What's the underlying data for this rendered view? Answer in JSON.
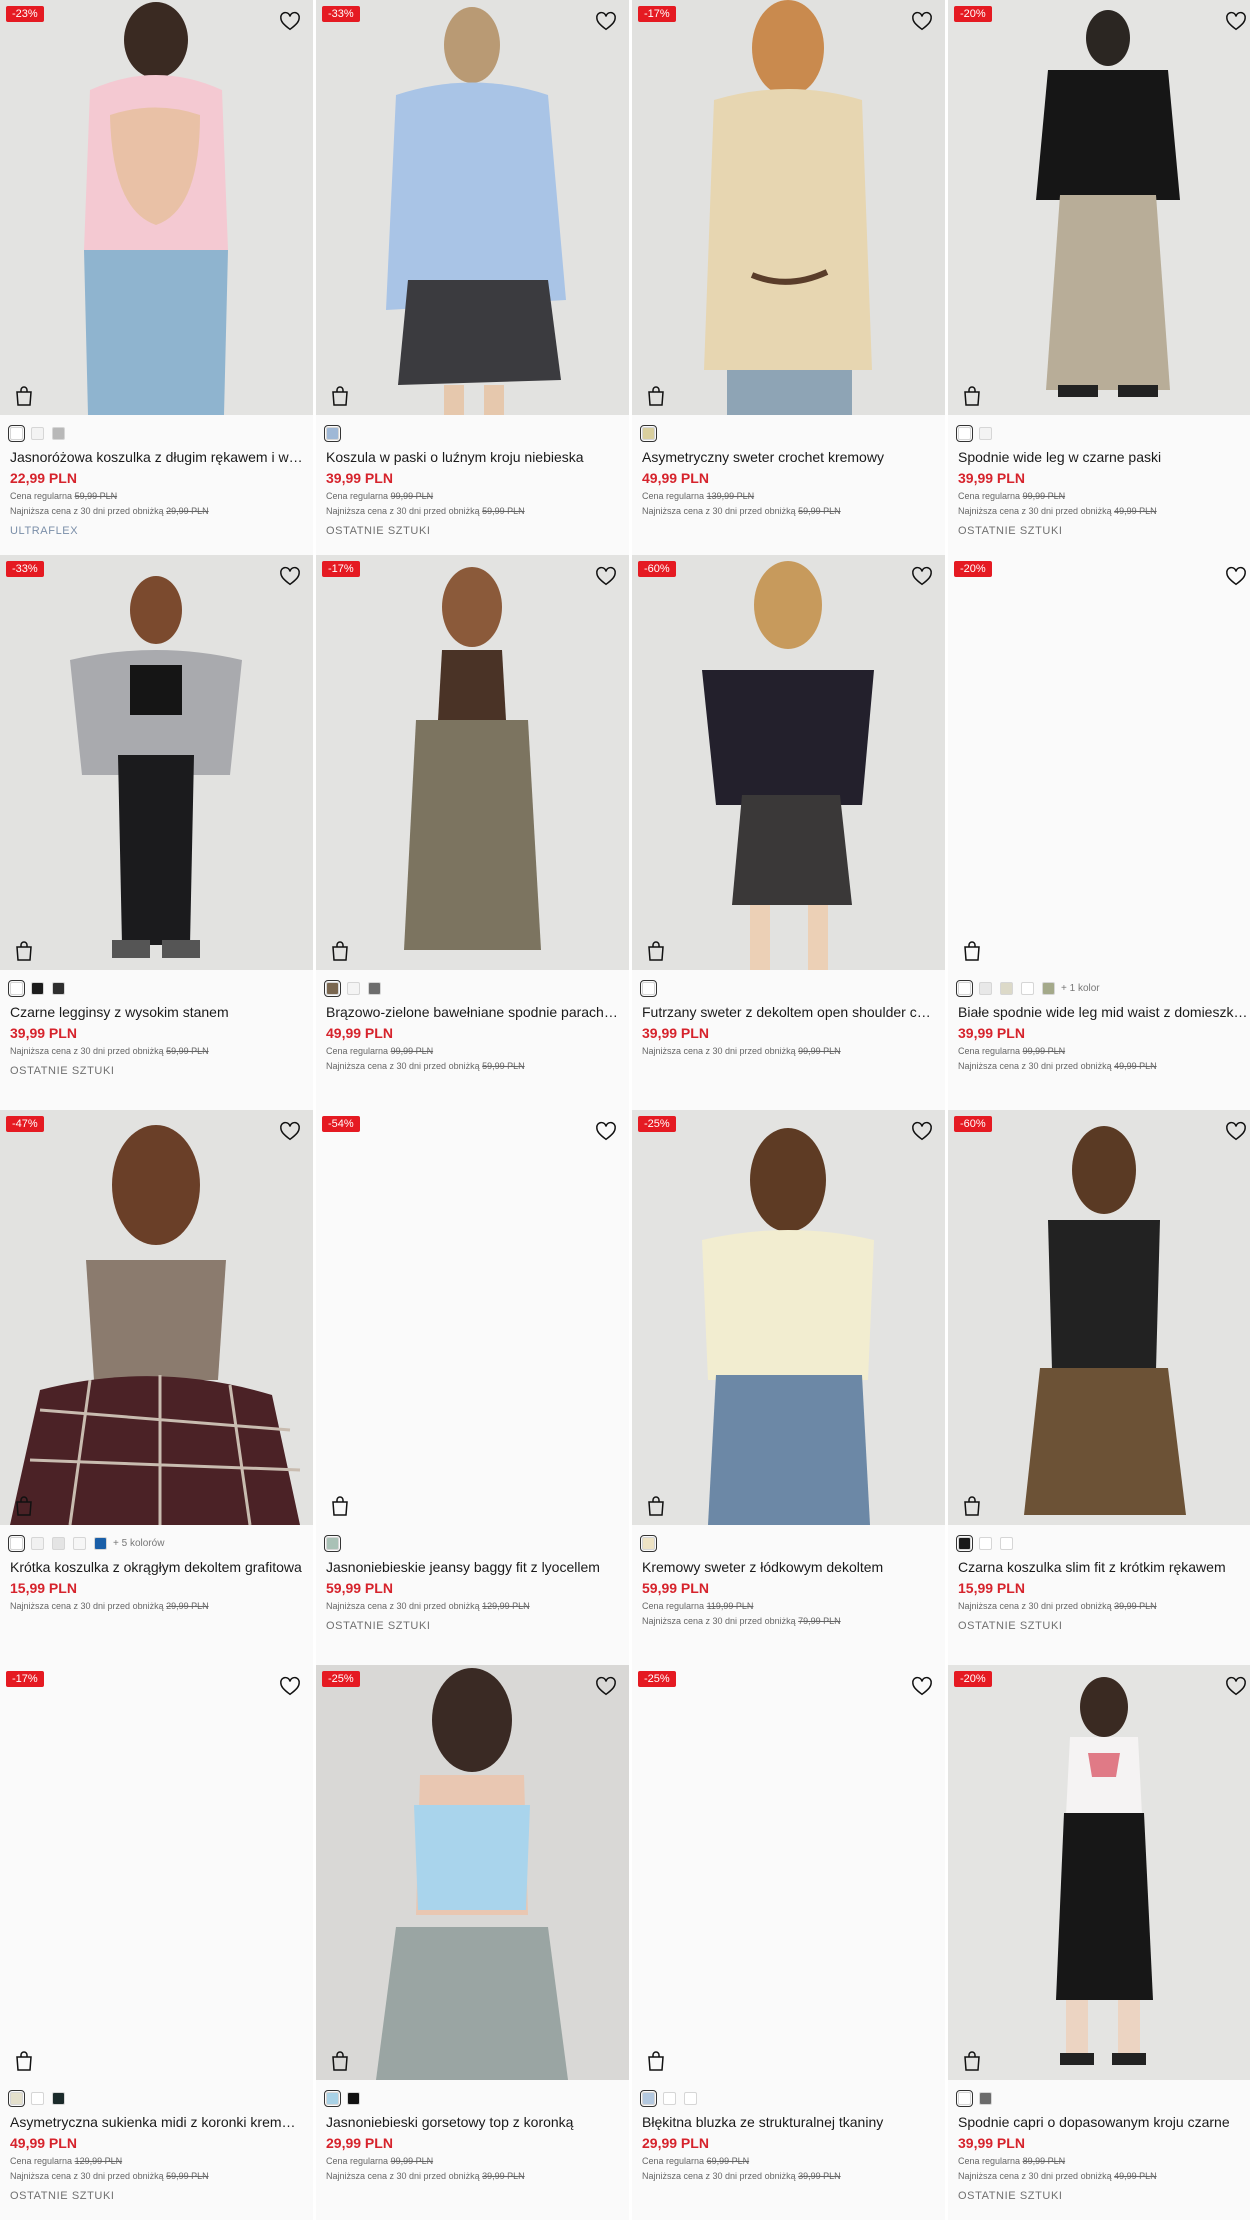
{
  "labels": {
    "regular": "Cena regularna",
    "lowest": "Najniższa cena z 30 dni przed obniżką"
  },
  "colors": {
    "sale_badge": "#e51a22",
    "price": "#d6232c"
  },
  "products": [
    {
      "discount": "-23%",
      "name": "Jasnoróżowa koszulka z długim rękawem i wycięciem",
      "price": "22,99 PLN",
      "regular": "",
      "lowest": "59,99 PLN",
      "lowest2": "29,99 PLN",
      "tag": "ULTRAFLEX",
      "swatches": [
        "#ffffff",
        "#f3f3f3",
        "#b8b8b8"
      ],
      "more": ""
    },
    {
      "discount": "-33%",
      "name": "Koszula w paski o luźnym kroju niebieska",
      "price": "39,99 PLN",
      "regular": "99,99 PLN",
      "lowest": "59,99 PLN",
      "tag": "OSTATNIE SZTUKI",
      "swatches": [
        "#9fb8d6"
      ],
      "more": ""
    },
    {
      "discount": "-17%",
      "name": "Asymetryczny sweter crochet kremowy",
      "price": "49,99 PLN",
      "regular": "139,99 PLN",
      "lowest": "59,99 PLN",
      "tag": "",
      "swatches": [
        "#d9cf9e"
      ],
      "more": ""
    },
    {
      "discount": "-20%",
      "name": "Spodnie wide leg w czarne paski",
      "price": "39,99 PLN",
      "regular": "99,99 PLN",
      "lowest": "49,99 PLN",
      "tag": "OSTATNIE SZTUKI",
      "swatches": [
        "#ffffff",
        "#f3f3f3"
      ],
      "more": ""
    },
    {
      "discount": "-33%",
      "name": "Czarne legginsy z wysokim stanem",
      "price": "39,99 PLN",
      "regular": "",
      "lowest": "59,99 PLN",
      "tag": "OSTATNIE SZTUKI",
      "swatches": [
        "#ffffff",
        "#1c1c1c",
        "#2e2e2e"
      ],
      "more": ""
    },
    {
      "discount": "-17%",
      "name": "Brązowo-zielone bawełniane spodnie parachute",
      "price": "49,99 PLN",
      "regular": "99,99 PLN",
      "lowest": "59,99 PLN",
      "tag": "",
      "swatches": [
        "#7a6750",
        "#f4f4f4",
        "#6d6d6d"
      ],
      "more": ""
    },
    {
      "discount": "-60%",
      "name": "Futrzany sweter z dekoltem open shoulder czarny",
      "price": "39,99 PLN",
      "regular": "",
      "lowest": "99,99 PLN",
      "tag": "",
      "swatches": [
        "#ffffff"
      ],
      "more": ""
    },
    {
      "discount": "-20%",
      "name": "Białe spodnie wide leg mid waist z domieszką lnu",
      "price": "39,99 PLN",
      "regular": "99,99 PLN",
      "lowest": "49,99 PLN",
      "tag": "",
      "swatches": [
        "#ffffff",
        "#e8e8e8",
        "#dcd9c8",
        "#ffffff",
        "#a4a98a"
      ],
      "more": "+ 1 kolor"
    },
    {
      "discount": "-47%",
      "name": "Krótka koszulka z okrągłym dekoltem grafitowa",
      "price": "15,99 PLN",
      "regular": "",
      "lowest": "29,99 PLN",
      "tag": "",
      "swatches": [
        "#ffffff",
        "#f1f1f1",
        "#e4e4e4",
        "#f6f6f6",
        "#1a5fa8"
      ],
      "more": "+ 5 kolorów"
    },
    {
      "discount": "-54%",
      "name": "Jasnoniebieskie jeansy baggy fit z lyocellem",
      "price": "59,99 PLN",
      "regular": "",
      "lowest": "129,99 PLN",
      "tag": "OSTATNIE SZTUKI",
      "swatches": [
        "#a9c1b6"
      ],
      "more": ""
    },
    {
      "discount": "-25%",
      "name": "Kremowy sweter z łódkowym dekoltem",
      "price": "59,99 PLN",
      "regular": "119,99 PLN",
      "lowest": "79,99 PLN",
      "tag": "",
      "swatches": [
        "#eee3c4"
      ],
      "more": ""
    },
    {
      "discount": "-60%",
      "name": "Czarna koszulka slim fit z krótkim rękawem",
      "price": "15,99 PLN",
      "regular": "",
      "lowest": "39,99 PLN",
      "tag": "OSTATNIE SZTUKI",
      "swatches": [
        "#1a1a1a",
        "#ffffff",
        "#ffffff"
      ],
      "more": ""
    },
    {
      "discount": "-17%",
      "name": "Asymetryczna sukienka midi z koronki kremowa",
      "price": "49,99 PLN",
      "regular": "129,99 PLN",
      "lowest": "59,99 PLN",
      "tag": "OSTATNIE SZTUKI",
      "swatches": [
        "#e4e0cc",
        "#ffffff",
        "#1a2a2a"
      ],
      "more": ""
    },
    {
      "discount": "-25%",
      "name": "Jasnoniebieski gorsetowy top z koronką",
      "price": "29,99 PLN",
      "regular": "99,99 PLN",
      "lowest": "39,99 PLN",
      "tag": "",
      "swatches": [
        "#a9d2e6",
        "#111111"
      ],
      "more": ""
    },
    {
      "discount": "-25%",
      "name": "Błękitna bluzka ze strukturalnej tkaniny",
      "price": "29,99 PLN",
      "regular": "69,99 PLN",
      "lowest": "39,99 PLN",
      "tag": "",
      "swatches": [
        "#b3c8df",
        "#ffffff",
        "#ffffff"
      ],
      "more": ""
    },
    {
      "discount": "-20%",
      "name": "Spodnie capri o dopasowanym kroju czarne",
      "price": "39,99 PLN",
      "regular": "89,99 PLN",
      "lowest": "49,99 PLN",
      "tag": "OSTATNIE SZTUKI",
      "swatches": [
        "#ffffff",
        "#6b6b6b"
      ],
      "more": ""
    }
  ]
}
